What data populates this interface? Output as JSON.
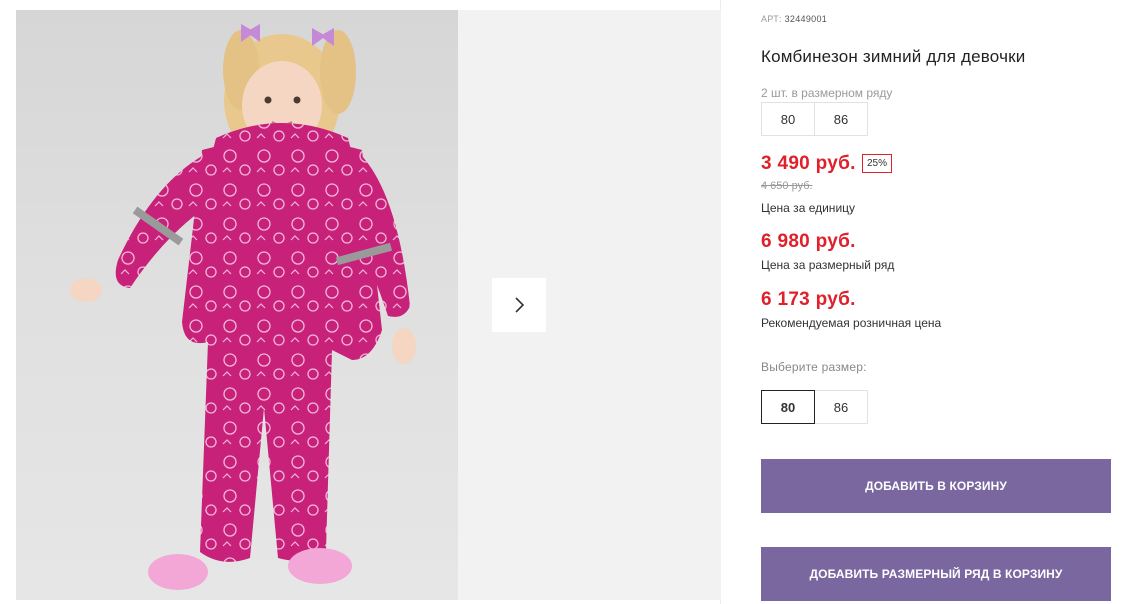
{
  "product": {
    "article_prefix": "АРТ:",
    "article": "32449001",
    "title": "Комбинезон зимний для девочки",
    "pack_note": "2 шт. в размерном ряду",
    "pack_sizes": [
      "80",
      "86"
    ],
    "price_unit": "3 490 руб.",
    "discount": "25%",
    "old_price": "4 650 руб.",
    "price_unit_label": "Цена за единицу",
    "price_pack": "6 980 руб.",
    "price_pack_label": "Цена за размерный ряд",
    "price_retail": "6 173 руб.",
    "price_retail_label": "Рекомендуемая розничная цена",
    "choose_size_label": "Выберите размер:",
    "sizes": [
      "80",
      "86"
    ],
    "selected_size": "80"
  },
  "actions": {
    "add_to_cart": "Добавить в корзину",
    "add_pack_to_cart": "Добавить размерный ряд в корзину"
  },
  "gallery": {
    "next_icon": "chevron-right-icon",
    "accent_color": "#c8217a"
  },
  "colors": {
    "price_red": "#e0202a",
    "button_purple": "#7a67a0"
  }
}
